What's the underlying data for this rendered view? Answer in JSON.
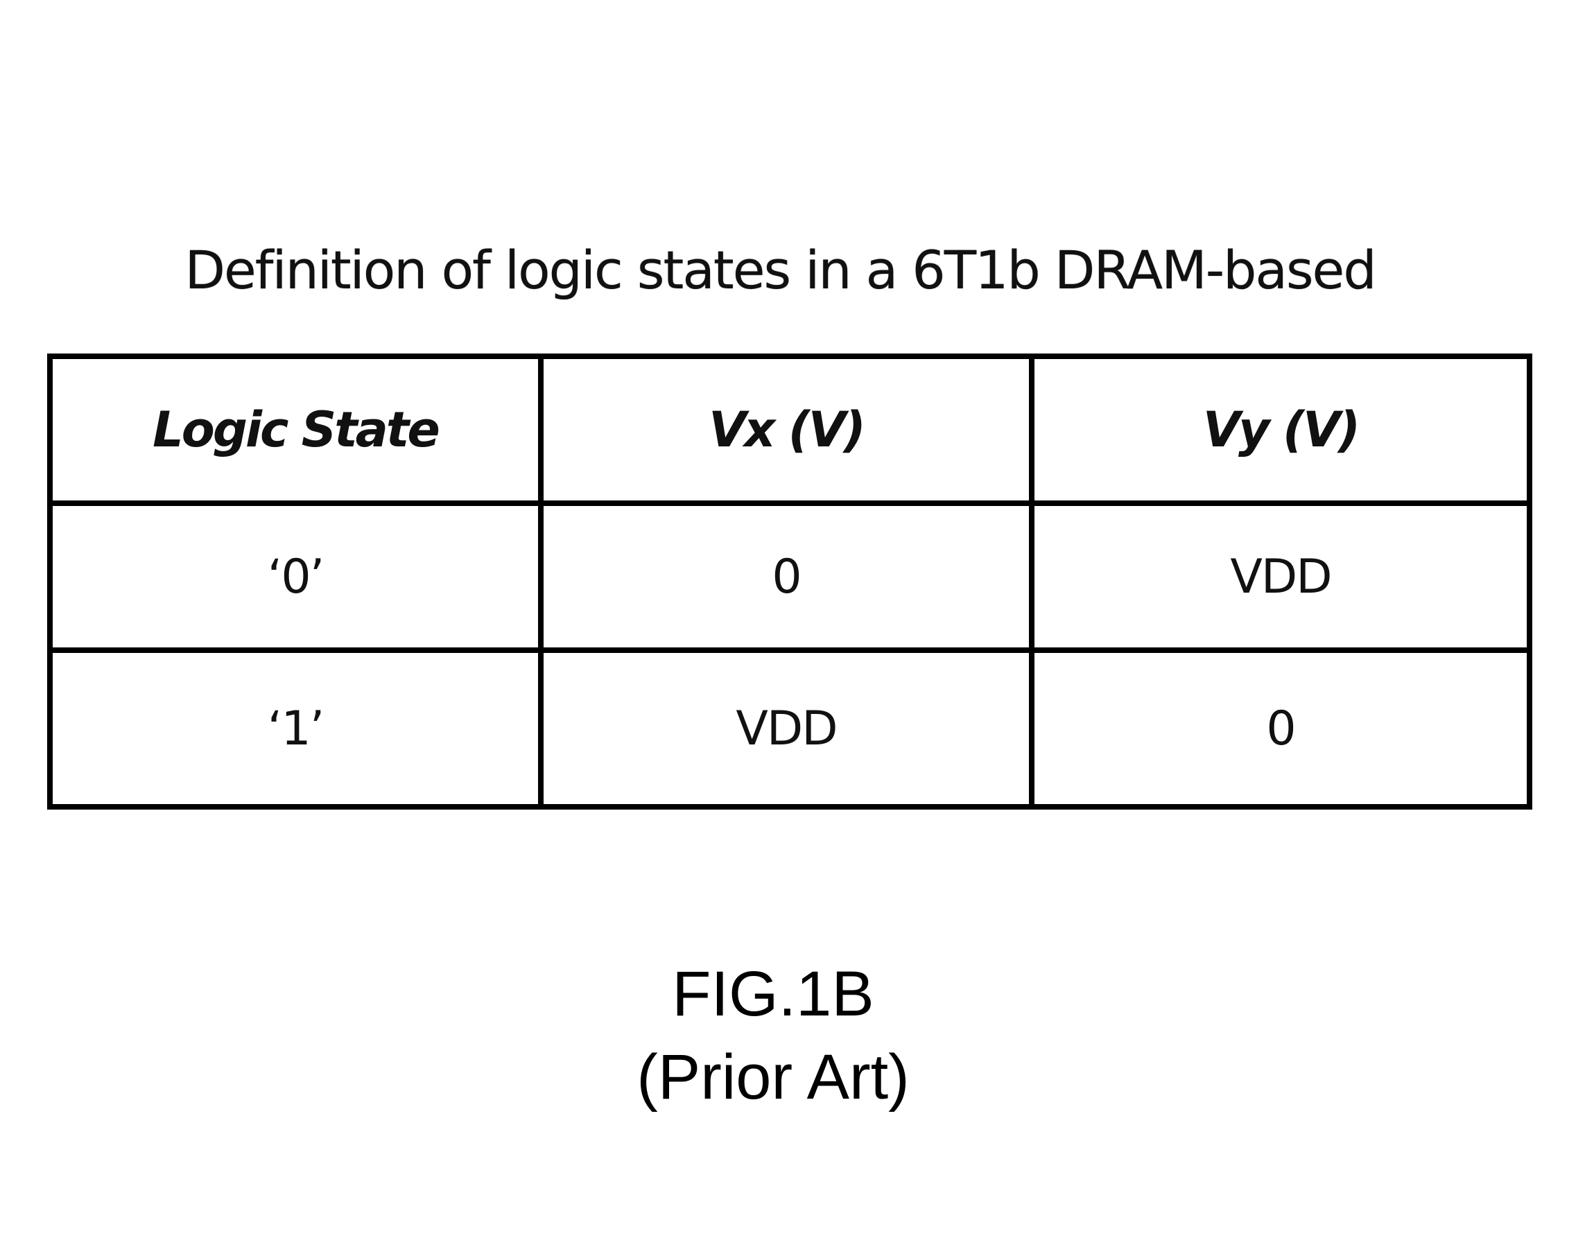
{
  "title": "Definition of logic states in a 6T1b DRAM-based",
  "table": {
    "headers": [
      "Logic State",
      "Vx (V)",
      "Vy (V)"
    ],
    "rows": [
      [
        "‘0’",
        "0",
        "VDD"
      ],
      [
        "‘1’",
        "VDD",
        "0"
      ]
    ]
  },
  "caption": {
    "figure_label": "FIG.1B",
    "note": "(Prior Art)"
  }
}
